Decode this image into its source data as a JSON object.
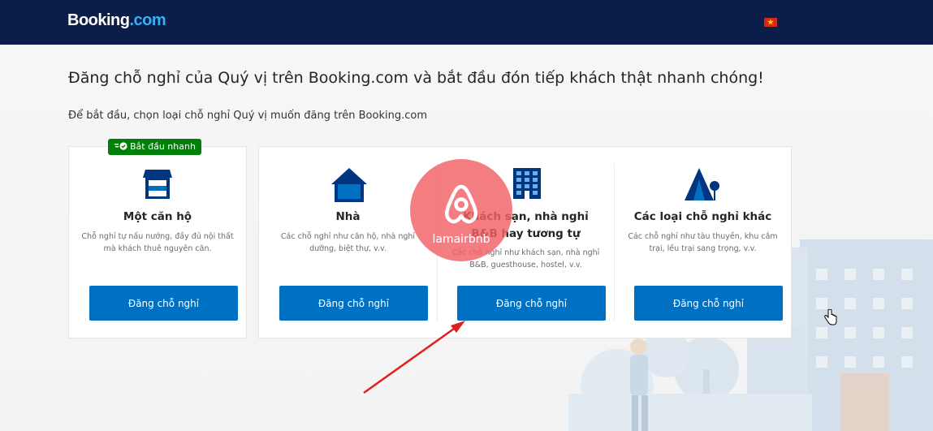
{
  "header": {
    "logo_part1": "Booking",
    "logo_part2": ".com",
    "language_flag": "vietnam-flag-icon",
    "colors": {
      "bar": "#0b1e4a",
      "logo_accent": "#38b0f5"
    }
  },
  "page": {
    "title": "Đăng chỗ nghỉ của Quý vị trên Booking.com và bắt đầu đón tiếp khách thật nhanh chóng!",
    "subtitle": "Để bắt đầu, chọn loại chỗ nghỉ Quý vị muốn đăng trên Booking.com"
  },
  "options": [
    {
      "badge": "Bắt đầu nhanh",
      "icon": "apartment-icon",
      "title": "Một căn hộ",
      "description": "Chỗ nghỉ tự nấu nướng, đầy đủ nội thất mà khách thuê nguyên căn.",
      "button": "Đăng chỗ nghỉ"
    },
    {
      "icon": "house-icon",
      "title": "Nhà",
      "description": "Các chỗ nghỉ như căn hộ, nhà nghỉ dưỡng, biệt thự, v.v.",
      "button": "Đăng chỗ nghỉ"
    },
    {
      "icon": "hotel-icon",
      "title": "Khách sạn, nhà nghỉ B&B hay tương tự",
      "description": "Các chỗ nghỉ như khách sạn, nhà nghỉ B&B, guesthouse, hostel, v.v.",
      "button": "Đăng chỗ nghỉ"
    },
    {
      "icon": "tent-icon",
      "title": "Các loại chỗ nghỉ khác",
      "description": "Các chỗ nghỉ như tàu thuyền, khu cắm trại, lều trại sang trọng, v.v.",
      "button": "Đăng chỗ nghỉ"
    }
  ],
  "watermark": {
    "text": "lamairbnb",
    "icon": "airbnb-logo-icon",
    "color": "#f26066"
  },
  "colors": {
    "primary_button": "#0071c2",
    "badge": "#008009",
    "annotation_arrow": "#e02020"
  }
}
